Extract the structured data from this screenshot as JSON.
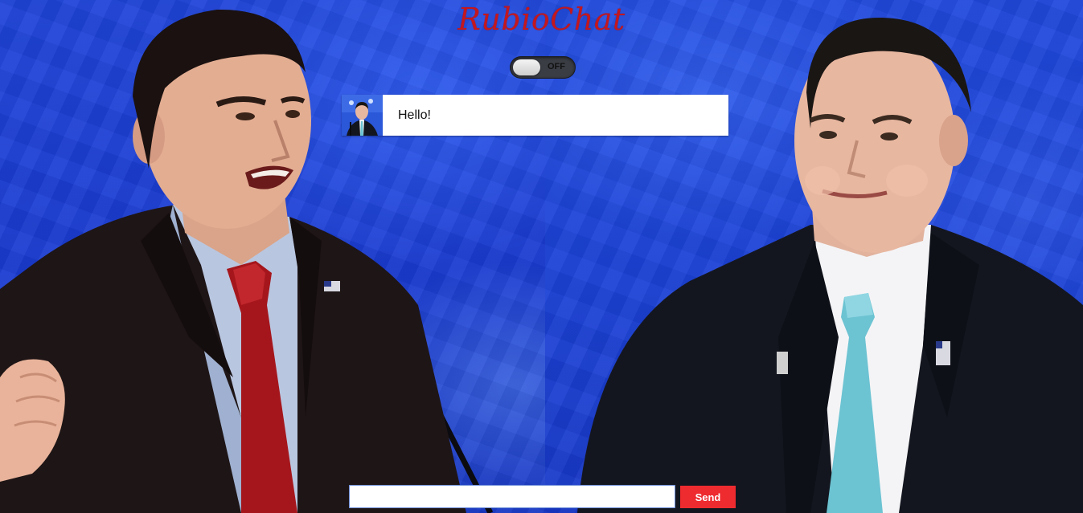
{
  "app": {
    "title": "RubioChat"
  },
  "toggle": {
    "state_label": "OFF",
    "is_on": false
  },
  "messages": [
    {
      "text": "Hello!",
      "avatar": "christie-avatar"
    }
  ],
  "composer": {
    "value": "",
    "placeholder": "",
    "send_label": "Send"
  },
  "colors": {
    "title": "#c3171f",
    "send_button": "#ee2b2f",
    "backdrop": "#1c3fd6"
  }
}
